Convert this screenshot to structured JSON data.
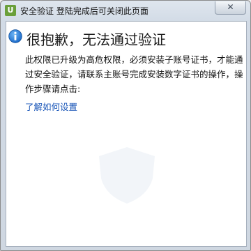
{
  "window": {
    "title": "安全验证 登陆完成后可关闭此页面",
    "app_icon_glyph": "U",
    "close_glyph": "✕"
  },
  "message": {
    "headline": "很抱歉，无法通过验证",
    "body": "此权限已升级为高危权限，必须安装子账号证书，才能通过安全验证，请联系主账号完成安装数字证书的操作，操作步骤请点击:",
    "link": "了解如何设置"
  },
  "icons": {
    "info": "info-icon",
    "close": "close-icon",
    "app": "app-icon"
  },
  "colors": {
    "link": "#1a56b8",
    "info": "#1f7fd6"
  }
}
